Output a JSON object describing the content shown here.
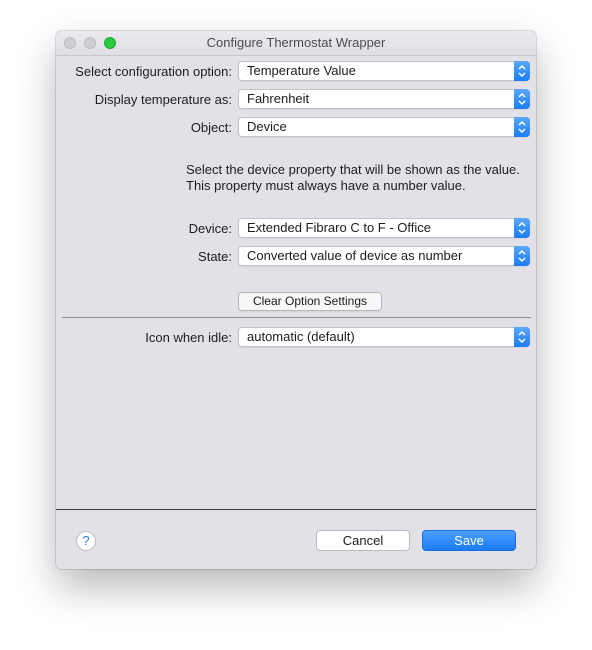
{
  "window": {
    "title": "Configure Thermostat Wrapper"
  },
  "form": {
    "config_option": {
      "label": "Select configuration option:",
      "value": "Temperature Value"
    },
    "display_temp": {
      "label": "Display temperature as:",
      "value": "Fahrenheit"
    },
    "object": {
      "label": "Object:",
      "value": "Device"
    },
    "help_text": "Select the device property that will be shown as the value.  This property must always have a number value.",
    "device": {
      "label": "Device:",
      "value": "Extended Fibraro C to F - Office"
    },
    "state": {
      "label": "State:",
      "value": "Converted value of device as number"
    },
    "clear_button": "Clear Option Settings",
    "icon_idle": {
      "label": "Icon when idle:",
      "value": "automatic (default)"
    }
  },
  "footer": {
    "help_glyph": "?",
    "cancel_label": "Cancel",
    "save_label": "Save"
  },
  "icons": {
    "popup_arrows": "updown-chevron-icon",
    "help": "help-icon"
  },
  "colors": {
    "accent": "#1c7cf4",
    "window_bg": "#e3e1e8",
    "zoom_button": "#28c840"
  }
}
